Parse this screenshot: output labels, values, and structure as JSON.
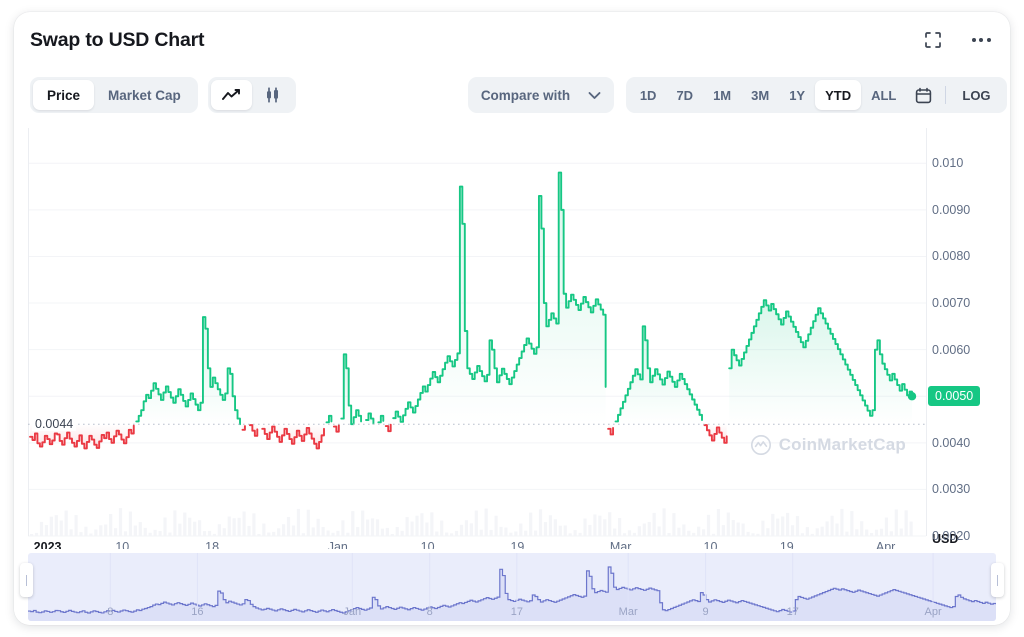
{
  "header": {
    "title": "Swap to USD Chart",
    "fullscreen_icon": "fullscreen-icon",
    "more_icon": "more-options-icon"
  },
  "toolbar": {
    "price_label": "Price",
    "marketcap_label": "Market Cap",
    "line_chart_icon": "line-chart-icon",
    "candlestick_icon": "candlestick-chart-icon",
    "compare_label": "Compare with",
    "compare_chevron": "chevron-down-icon",
    "ranges": [
      "1D",
      "7D",
      "1M",
      "3M",
      "1Y",
      "YTD",
      "ALL"
    ],
    "active_range": "YTD",
    "calendar_icon": "calendar-icon",
    "log_label": "LOG"
  },
  "chart_data": {
    "type": "line",
    "title": "Swap to USD Chart",
    "xlabel": "",
    "ylabel": "USD",
    "ylim": [
      0.002,
      0.0105
    ],
    "yticks": [
      "0.010",
      "0.0090",
      "0.0080",
      "0.0070",
      "0.0060",
      "0.0050",
      "0.0040",
      "0.0030",
      "0.0020"
    ],
    "ytick_values": [
      0.01,
      0.009,
      0.008,
      0.007,
      0.006,
      0.005,
      0.004,
      0.003,
      0.002
    ],
    "current_price_label": "0.0050",
    "current_price": 0.005,
    "baseline_label": "0.0044",
    "baseline_value": 0.0044,
    "unit": "USD",
    "grid": true,
    "legend": "none",
    "watermark": "CoinMarketCap",
    "up_color": "#16c784",
    "down_color": "#ea3943",
    "xticks": [
      "2023",
      "10",
      "18",
      "Jan",
      "10",
      "19",
      "Mar",
      "10",
      "19",
      "Apr"
    ],
    "xtick_positions": [
      0.004,
      0.105,
      0.205,
      0.345,
      0.445,
      0.545,
      0.66,
      0.76,
      0.845,
      0.955
    ],
    "values": [
      0.00413,
      0.00406,
      0.0042,
      0.00399,
      0.00392,
      0.00401,
      0.00415,
      0.00408,
      0.00397,
      0.00405,
      0.0042,
      0.00418,
      0.00404,
      0.00396,
      0.0041,
      0.00422,
      0.00409,
      0.004,
      0.00392,
      0.00404,
      0.00416,
      0.00398,
      0.00388,
      0.00402,
      0.00415,
      0.00407,
      0.00396,
      0.00389,
      0.00403,
      0.00417,
      0.0041,
      0.00422,
      0.00408,
      0.004,
      0.00414,
      0.00426,
      0.00418,
      0.00407,
      0.00399,
      0.00412,
      0.00428,
      0.0042,
      0.00437,
      0.00446,
      0.00458,
      0.0047,
      0.00489,
      0.00503,
      0.00496,
      0.00512,
      0.00528,
      0.00516,
      0.00504,
      0.00492,
      0.00508,
      0.00521,
      0.00509,
      0.00497,
      0.00486,
      0.005,
      0.00515,
      0.00503,
      0.0049,
      0.00478,
      0.00492,
      0.00506,
      0.00494,
      0.00482,
      0.0047,
      0.00486,
      0.0067,
      0.00645,
      0.0056,
      0.0052,
      0.0054,
      0.00528,
      0.00515,
      0.00503,
      0.00492,
      0.00506,
      0.0056,
      0.00548,
      0.005,
      0.0047,
      0.00452,
      0.0044,
      0.00428,
      0.00436,
      0.00448,
      0.00438,
      0.00426,
      0.00415,
      0.00429,
      0.00441,
      0.0043,
      0.00419,
      0.00408,
      0.00422,
      0.00435,
      0.00424,
      0.00413,
      0.00402,
      0.00416,
      0.0043,
      0.00419,
      0.00408,
      0.00398,
      0.00412,
      0.00426,
      0.00415,
      0.00404,
      0.00418,
      0.00432,
      0.0042,
      0.00409,
      0.00398,
      0.00388,
      0.00402,
      0.00416,
      0.0043,
      0.00444,
      0.00458,
      0.00446,
      0.00435,
      0.00424,
      0.00438,
      0.00452,
      0.0059,
      0.0056,
      0.0048,
      0.0044,
      0.00455,
      0.0047,
      0.00458,
      0.00446,
      0.00435,
      0.00449,
      0.00463,
      0.00452,
      0.00441,
      0.0043,
      0.00444,
      0.00458,
      0.00447,
      0.00436,
      0.00425,
      0.00439,
      0.00453,
      0.00467,
      0.00456,
      0.00445,
      0.00459,
      0.00473,
      0.00487,
      0.00476,
      0.00465,
      0.00479,
      0.00493,
      0.00507,
      0.00521,
      0.0051,
      0.00524,
      0.00538,
      0.00552,
      0.00541,
      0.0053,
      0.00544,
      0.00558,
      0.00572,
      0.00586,
      0.00575,
      0.00564,
      0.00578,
      0.00592,
      0.0095,
      0.0087,
      0.0064,
      0.0056,
      0.00548,
      0.00537,
      0.00551,
      0.00565,
      0.00554,
      0.00543,
      0.00532,
      0.00546,
      0.0062,
      0.006,
      0.0056,
      0.0053,
      0.00545,
      0.00559,
      0.00548,
      0.00537,
      0.00526,
      0.0054,
      0.00554,
      0.00568,
      0.00582,
      0.00596,
      0.0061,
      0.00624,
      0.00613,
      0.00602,
      0.00591,
      0.00605,
      0.0093,
      0.0086,
      0.007,
      0.0065,
      0.00664,
      0.00678,
      0.00667,
      0.00656,
      0.0098,
      0.009,
      0.0072,
      0.0069,
      0.00704,
      0.00718,
      0.00707,
      0.00696,
      0.00685,
      0.00699,
      0.00713,
      0.00702,
      0.00691,
      0.0068,
      0.00694,
      0.00708,
      0.00697,
      0.00686,
      0.00675,
      0.0052,
      0.0043,
      0.00418,
      0.00432,
      0.00446,
      0.0046,
      0.00474,
      0.00488,
      0.00502,
      0.00516,
      0.0053,
      0.00544,
      0.00558,
      0.00547,
      0.00536,
      0.0065,
      0.0062,
      0.0056,
      0.0053,
      0.00544,
      0.00558,
      0.00547,
      0.00536,
      0.00525,
      0.00539,
      0.00553,
      0.00542,
      0.00531,
      0.0052,
      0.00534,
      0.00548,
      0.00537,
      0.00526,
      0.00515,
      0.00504,
      0.00493,
      0.00482,
      0.00471,
      0.0046,
      0.00449,
      0.00438,
      0.00427,
      0.00416,
      0.00405,
      0.00419,
      0.00433,
      0.00422,
      0.00411,
      0.004,
      0.00414,
      0.0056,
      0.006,
      0.00588,
      0.00577,
      0.00566,
      0.0058,
      0.00594,
      0.00608,
      0.00622,
      0.00636,
      0.0065,
      0.00664,
      0.00678,
      0.00692,
      0.00706,
      0.00695,
      0.00684,
      0.00698,
      0.00687,
      0.00676,
      0.00665,
      0.00654,
      0.00668,
      0.00682,
      0.00671,
      0.0066,
      0.00649,
      0.00638,
      0.00627,
      0.00616,
      0.00605,
      0.00619,
      0.00633,
      0.00647,
      0.00661,
      0.00675,
      0.00689,
      0.00678,
      0.00667,
      0.00656,
      0.00645,
      0.00634,
      0.00623,
      0.00612,
      0.00601,
      0.0059,
      0.00579,
      0.00568,
      0.00557,
      0.00546,
      0.00535,
      0.00524,
      0.00513,
      0.00502,
      0.00491,
      0.0048,
      0.00469,
      0.00458,
      0.0047,
      0.006,
      0.0062,
      0.0059,
      0.0057,
      0.00558,
      0.00546,
      0.00534,
      0.00548,
      0.00536,
      0.00524,
      0.00512,
      0.00526,
      0.00514,
      0.00502,
      0.0051,
      0.005
    ]
  },
  "navigator": {
    "labels": [
      "8",
      "16",
      "Jan",
      "8",
      "17",
      "Mar",
      "9",
      "17",
      "Apr"
    ],
    "label_positions": [
      0.085,
      0.175,
      0.335,
      0.415,
      0.505,
      0.62,
      0.7,
      0.79,
      0.935
    ],
    "left_handle": "navigator-left-handle",
    "right_handle": "navigator-right-handle"
  }
}
